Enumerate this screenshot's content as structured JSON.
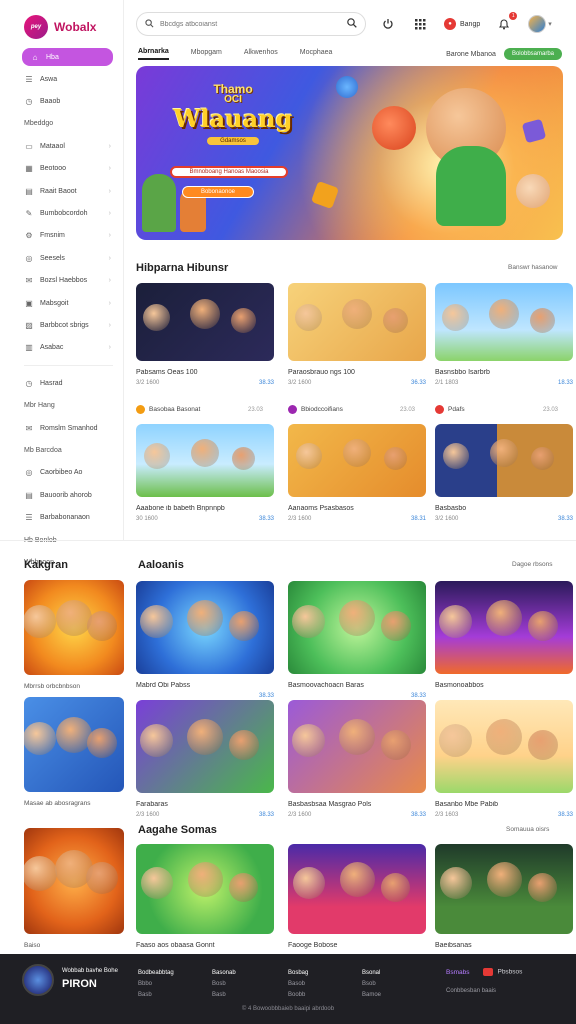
{
  "brand": {
    "logo_text": "pey",
    "name": "Wobalx"
  },
  "sidebar": {
    "items": [
      {
        "label": "Hba",
        "icon": "home-icon",
        "active": true
      },
      {
        "label": "Aswa",
        "icon": "list-icon"
      },
      {
        "label": "Baaob",
        "icon": "clock-icon"
      },
      {
        "label": "Mbeddgo",
        "icon": ""
      },
      {
        "label": "Mataaol",
        "icon": "gamepad-icon",
        "chev": true
      },
      {
        "label": "Beotooo",
        "icon": "grid-icon",
        "chev": true
      },
      {
        "label": "Raait Baoot",
        "icon": "card-icon",
        "chev": true
      },
      {
        "label": "Bumbobcordoh",
        "icon": "edit-icon",
        "chev": true
      },
      {
        "label": "Fmsnim",
        "icon": "settings-icon",
        "chev": true
      },
      {
        "label": "Seesels",
        "icon": "globe-icon",
        "chev": true
      },
      {
        "label": "Bozsl Haebbos",
        "icon": "mail-icon",
        "chev": true
      },
      {
        "label": "Mabsgoit",
        "icon": "inbox-icon",
        "chev": true
      },
      {
        "label": "Barbbcot sbrigs",
        "icon": "image-icon",
        "chev": true
      },
      {
        "label": "Asabac",
        "icon": "book-icon",
        "chev": true
      }
    ],
    "items2": [
      {
        "label": "Hasrad",
        "icon": "clock-icon"
      },
      {
        "label": "Mbr Hang",
        "icon": ""
      },
      {
        "label": "Romslm Smanhod",
        "icon": "mail-icon"
      },
      {
        "label": "Mb Barcdoa",
        "icon": ""
      },
      {
        "label": "Caorbibeo Ao",
        "icon": "globe-icon"
      },
      {
        "label": "Bauoorib ahorob",
        "icon": "doc-icon"
      },
      {
        "label": "Barbabonanaon",
        "icon": "list-icon"
      },
      {
        "label": "Hb Bonlob",
        "icon": ""
      },
      {
        "label": "Wbbaoon",
        "icon": ""
      }
    ]
  },
  "topbar": {
    "search_placeholder": "Bbcdgs atbcoianst",
    "pill_label": "Bangp",
    "notif_count": "1"
  },
  "tabs": {
    "items": [
      "Abrnarka",
      "Mbopgam",
      "Alkwenhos",
      "Mocphaea"
    ],
    "right_link": "Barone Mbanoa",
    "right_button": "Bolobbsamarba"
  },
  "hero": {
    "subtitle": "Thamo",
    "subtitle2": "OCI",
    "title": "Wlauang",
    "tag": "Gdamsos",
    "line": "Bmnoboang Hanoas Maoosia",
    "button": "Bobonaonoe"
  },
  "section1": {
    "title": "Hibparna Hibunsr",
    "link": "Banswr hasanow",
    "cards": [
      {
        "title": "Pabsams Oeas 100",
        "left": "3/2 1600",
        "right": "38.33",
        "thumb": "cubes-friends"
      },
      {
        "title": "Paraosbrauo ngs 100",
        "left": "3/2 1600",
        "right": "36.33",
        "thumb": "cartoon-group"
      },
      {
        "title": "Basnsbbo Isarbrb",
        "left": "2/1 1803",
        "right": "18.33",
        "thumb": "kids-playing"
      }
    ],
    "source_row": [
      {
        "label": "Basobaa Basonat",
        "right": "23.03",
        "color": "#f39c12"
      },
      {
        "label": "Bbiodccoifians",
        "right": "23.03",
        "color": "#9c27b0"
      },
      {
        "label": "Pdafs",
        "right": "23.03",
        "color": "#e53935"
      }
    ],
    "cards2": [
      {
        "title": "Aaabone ib babeth Bnpnnpb",
        "left": "30 1600",
        "right": "38.33",
        "thumb": "kids-park"
      },
      {
        "title": "Aanaoms Psasbasos",
        "left": "2/3 1600",
        "right": "38.31",
        "thumb": "cartoon-box"
      },
      {
        "title": "Basbasbo",
        "left": "3/2 1600",
        "right": "38.33",
        "thumb": "game-logo"
      }
    ]
  },
  "section2": {
    "left_title": "Kakgran",
    "title": "Aaloanis",
    "link": "Dagoe rbsons",
    "left_cards": [
      {
        "title": "Mbrrsb orbcbnbson",
        "thumb": "kakgran-1"
      },
      {
        "title": "Masae ab abosragrans",
        "thumb": "kakgran-2"
      }
    ],
    "cards": [
      {
        "title": "Mabrd Obi Pabss",
        "left": "",
        "right": "38.33",
        "thumb": "hero-cubes"
      },
      {
        "title": "Basmoovachoacn Baras",
        "left": "",
        "right": "38.33",
        "thumb": "lion-crew"
      },
      {
        "title": "Basmonoabbos",
        "left": "",
        "right": "",
        "thumb": "neon-street"
      },
      {
        "title": "Farabaras",
        "left": "2/3 1600",
        "right": "38.33",
        "thumb": "guerans"
      },
      {
        "title": "Basbasbsaa Masgrao Pols",
        "left": "2/3 1600",
        "right": "38.33",
        "thumb": "toy-friends"
      },
      {
        "title": "Basanbo Mbe Pabib",
        "left": "2/3 1603",
        "right": "38.33",
        "thumb": "kids-running"
      }
    ]
  },
  "section3": {
    "title": "Aagahe Somas",
    "link": "Somauua oisrs",
    "left_card": {
      "title": "Baiso",
      "thumb": "lion"
    },
    "cards": [
      {
        "title": "Faaso aos obaasa Gonnt",
        "thumb": "hubasg"
      },
      {
        "title": "Faooge Bobose",
        "thumb": "mage"
      },
      {
        "title": "Baeibsanas",
        "thumb": "saekee"
      }
    ]
  },
  "footer": {
    "brand_top": "Wobbab bavhe Bohe",
    "brand": "PIRON",
    "col1": [
      "Bodbeabbtag",
      "Bbbo",
      "Basb"
    ],
    "col2": [
      "Basonab",
      "Bosb",
      "Basb"
    ],
    "col3": [
      "Bosbag",
      "Basob",
      "Boobb"
    ],
    "col4": [
      "Bsonal",
      "Bsob",
      "Bamoe"
    ],
    "social1": "Bsmabs",
    "social2": "Pbsbsos",
    "social_sub": "Conbbesban baais",
    "copyright": "© 4 Bowoobbbaieb baaipi abrdoob"
  },
  "colors": {
    "accent": "#c455e0",
    "brand": "#c01460",
    "link_blue": "#3b86d9",
    "green": "#4caf50",
    "footer_bg": "#1f1f24"
  }
}
